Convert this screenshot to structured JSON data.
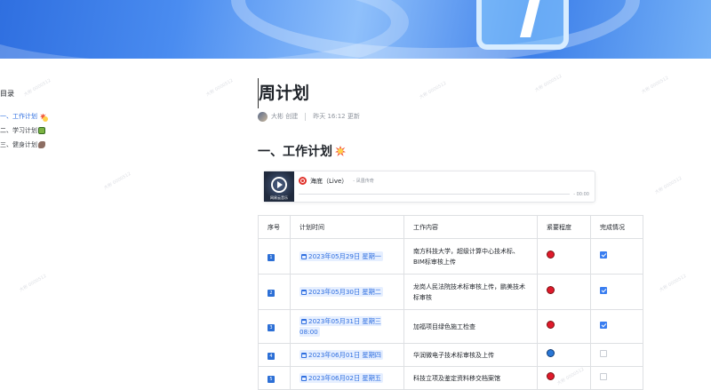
{
  "toc": {
    "title": "目录",
    "items": [
      {
        "label": "一、工作计划",
        "active": true
      },
      {
        "label": "二、学习计划",
        "active": false
      },
      {
        "label": "三、健身计划",
        "active": false
      }
    ]
  },
  "doc": {
    "title": "周计划",
    "author": "大彬 创建",
    "updated": "昨天 16:12 更新",
    "section_heading": "一、工作计划"
  },
  "music": {
    "cover_caption": "网易云音乐",
    "song": "海底（Live）",
    "artist": "- 凤凰传奇",
    "time": "- 00:00"
  },
  "table": {
    "headers": [
      "序号",
      "计划时间",
      "工作内容",
      "紧要程度",
      "完成情况"
    ],
    "rows": [
      {
        "no": "1",
        "date": "2023年05月29日 星期一",
        "content": "南方科技大学，超级计算中心技术标、BIM标审核上传",
        "urgency": "red",
        "done": true
      },
      {
        "no": "2",
        "date": "2023年05月30日 星期二",
        "content": "龙岗人民法院技术标审核上传，鹏美技术标审核",
        "urgency": "red",
        "done": true
      },
      {
        "no": "3",
        "date": "2023年05月31日 星期三 08:00",
        "content": "加福项目绿色施工检查",
        "urgency": "red",
        "done": true
      },
      {
        "no": "4",
        "date": "2023年06月01日 星期四",
        "content": "华润微电子技术标审核及上传",
        "urgency": "blue",
        "done": false
      },
      {
        "no": "5",
        "date": "2023年06月02日 星期五",
        "content": "科技立项及鉴定资料移交档案馆",
        "urgency": "red",
        "done": false
      }
    ]
  },
  "colors": {
    "accent": "#2f6fe0",
    "urgent_red": "#e0192b",
    "normal_blue": "#2a77d6",
    "checkbox_on": "#3a7ef0"
  }
}
